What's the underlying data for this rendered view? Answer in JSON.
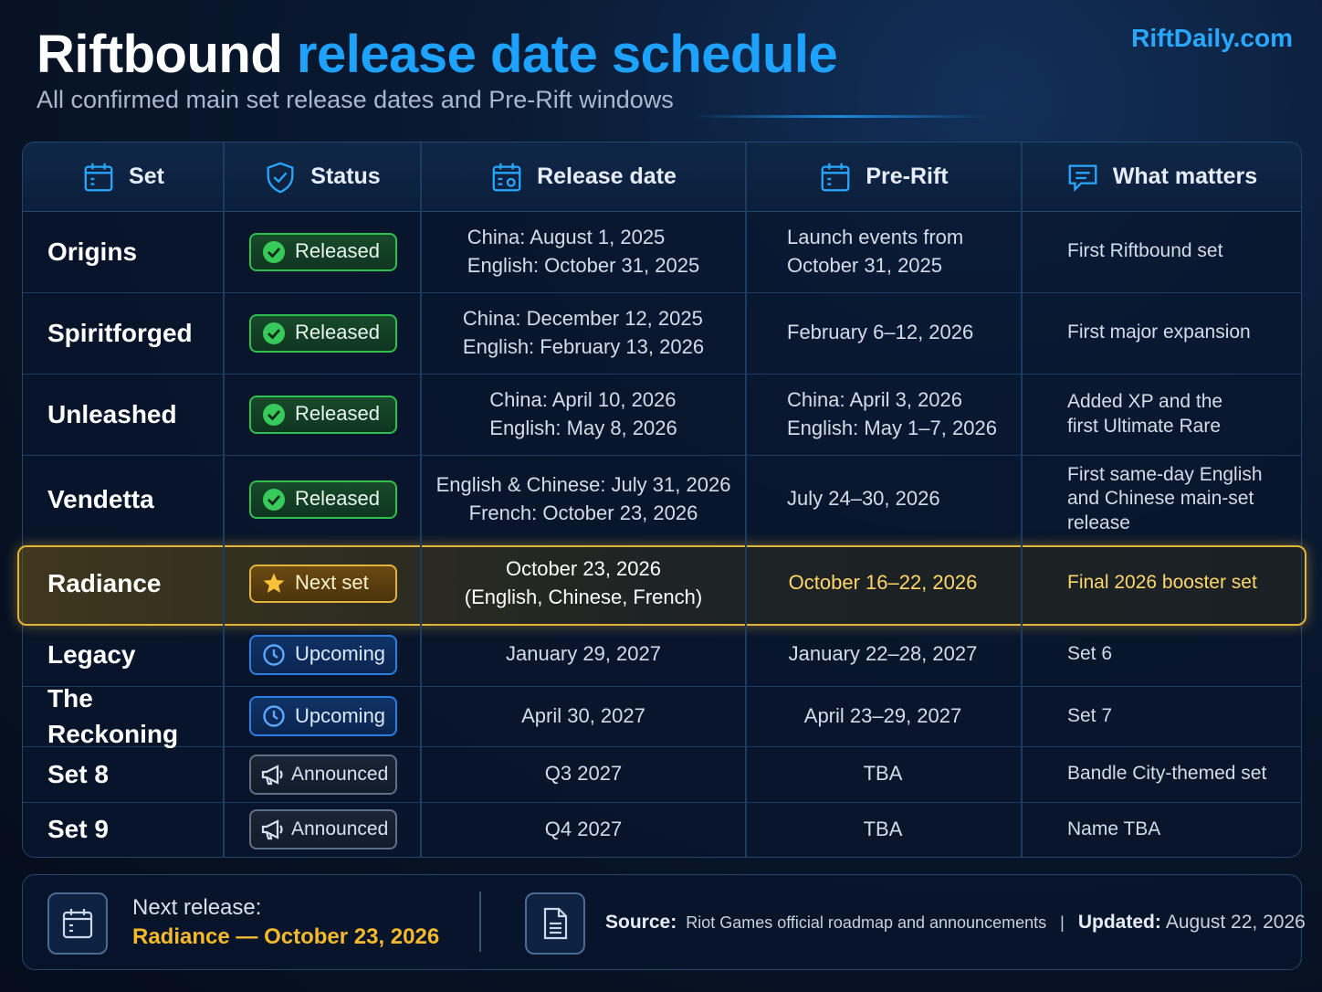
{
  "header": {
    "title_white": "Riftbound",
    "title_blue": "release date schedule",
    "subtitle": "All confirmed main set release dates and Pre-Rift windows",
    "brand": "RiftDaily.com"
  },
  "columns": {
    "set": "Set",
    "status": "Status",
    "release": "Release date",
    "prerift": "Pre-Rift",
    "what": "What matters"
  },
  "icons": [
    "calendar-icon",
    "shield-check-icon",
    "calendar-date-icon",
    "calendar-icon",
    "chat-icon"
  ],
  "colors": {
    "accent": "#1ea2ff",
    "released": "#2fbf4f",
    "next": "#e2b33a",
    "upcoming": "#2a7fe0",
    "announced": "#5f6f86"
  },
  "rows": [
    {
      "set": "Origins",
      "status": "Released",
      "release": [
        "China: August 1, 2025",
        "English: October 31, 2025"
      ],
      "prerift": [
        "Launch events from",
        "October 31, 2025"
      ],
      "what": [
        "First Riftbound set"
      ]
    },
    {
      "set": "Spiritforged",
      "status": "Released",
      "release": [
        "China: December 12, 2025",
        "English: February 13, 2026"
      ],
      "prerift": [
        "February 6–12, 2026"
      ],
      "what": [
        "First major expansion"
      ]
    },
    {
      "set": "Unleashed",
      "status": "Released",
      "release": [
        "China: April 10, 2026",
        "English: May 8, 2026"
      ],
      "prerift": [
        "China: April 3, 2026",
        "English: May 1–7, 2026"
      ],
      "what": [
        "Added XP and the",
        "first Ultimate Rare"
      ]
    },
    {
      "set": "Vendetta",
      "status": "Released",
      "release": [
        "English & Chinese: July 31, 2026",
        "French: October 23, 2026"
      ],
      "prerift": [
        "July 24–30, 2026"
      ],
      "what": [
        "First same-day English",
        "and Chinese main-set",
        "release"
      ]
    },
    {
      "set": "Radiance",
      "status": "Next set",
      "release": [
        "October 23, 2026",
        "(English, Chinese, French)"
      ],
      "prerift": [
        "October 16–22, 2026"
      ],
      "what": [
        "Final 2026 booster set"
      ]
    },
    {
      "set": "Legacy",
      "status": "Upcoming",
      "release": [
        "January 29, 2027"
      ],
      "prerift": [
        "January 22–28, 2027"
      ],
      "what": [
        "Set 6"
      ]
    },
    {
      "set": "The Reckoning",
      "status": "Upcoming",
      "release": [
        "April 30, 2027"
      ],
      "prerift": [
        "April 23–29, 2027"
      ],
      "what": [
        "Set 7"
      ]
    },
    {
      "set": "Set 8",
      "status": "Announced",
      "release": [
        "Q3 2027"
      ],
      "prerift": [
        "TBA"
      ],
      "what": [
        "Bandle City-themed set"
      ]
    },
    {
      "set": "Set 9",
      "status": "Announced",
      "release": [
        "Q4 2027"
      ],
      "prerift": [
        "TBA"
      ],
      "what": [
        "Name TBA"
      ]
    }
  ],
  "footer": {
    "next_label": "Next release:",
    "next_set": "Radiance",
    "next_sep": "—",
    "next_date": "October 23, 2026",
    "source_label": "Source:",
    "source_text": "Riot Games official roadmap and announcements",
    "sep": "|",
    "updated_label": "Updated:",
    "updated_text": "August 22, 2026"
  }
}
